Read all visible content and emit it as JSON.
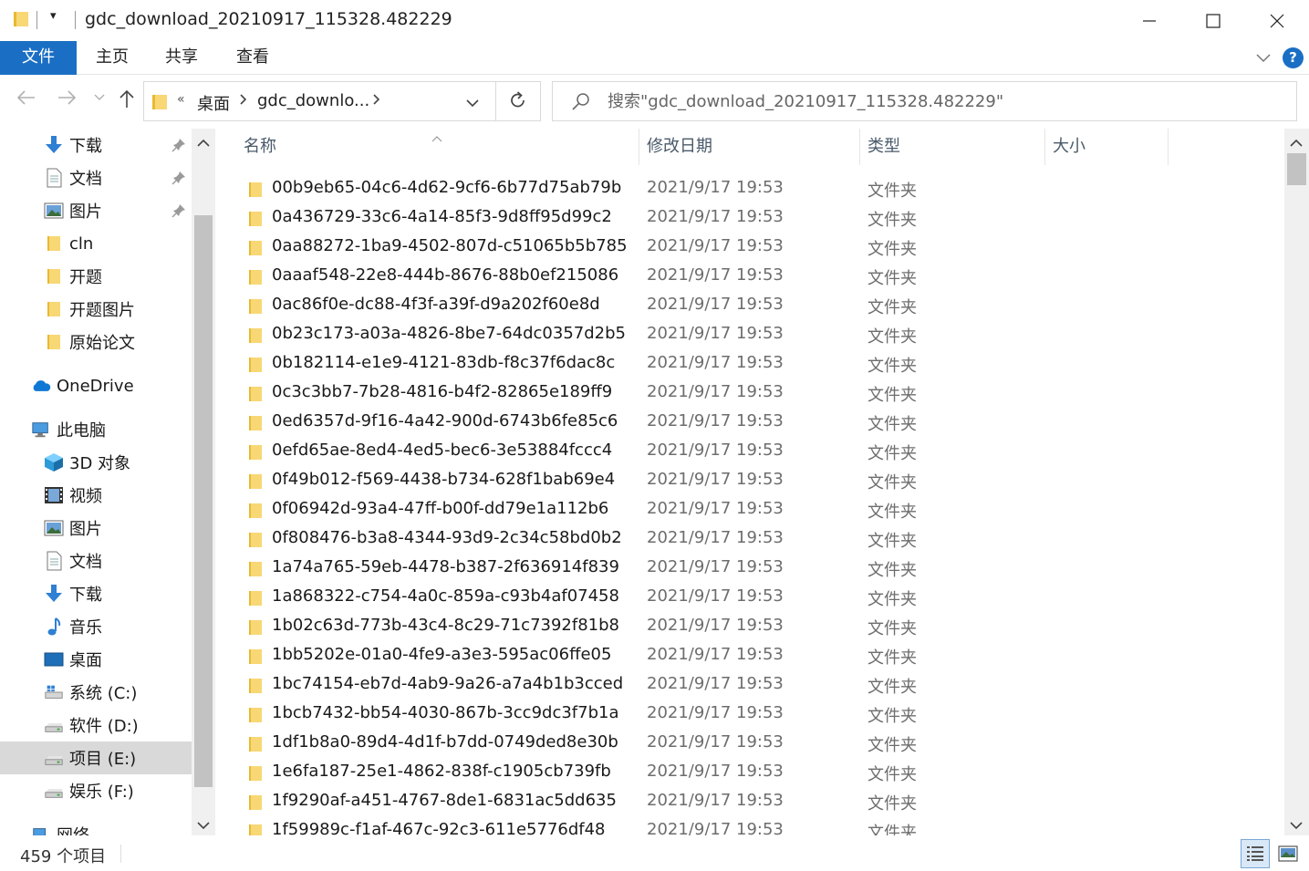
{
  "window": {
    "title": "gdc_download_20210917_115328.482229",
    "quick_access_dropdown": "▾"
  },
  "ribbon": {
    "tabs": [
      "文件",
      "主页",
      "共享",
      "查看"
    ],
    "help_label": "?"
  },
  "navbar": {
    "overflow": "«",
    "breadcrumb": [
      "桌面",
      "gdc_downlo..."
    ],
    "search_placeholder": "搜索\"gdc_download_20210917_115328.482229\""
  },
  "sidebar": {
    "items": [
      {
        "label": "下载",
        "icon": "download-arrow-icon",
        "pinned": true
      },
      {
        "label": "文档",
        "icon": "document-icon",
        "pinned": true
      },
      {
        "label": "图片",
        "icon": "pictures-icon",
        "pinned": true
      },
      {
        "label": "cln",
        "icon": "folder-icon",
        "pinned": false
      },
      {
        "label": "开题",
        "icon": "folder-icon",
        "pinned": false
      },
      {
        "label": "开题图片",
        "icon": "folder-icon",
        "pinned": false
      },
      {
        "label": "原始论文",
        "icon": "folder-icon",
        "pinned": false
      },
      {
        "label": "OneDrive",
        "icon": "onedrive-cloud-icon",
        "pinned": false
      },
      {
        "label": "此电脑",
        "icon": "this-pc-icon",
        "pinned": false
      },
      {
        "label": "3D 对象",
        "icon": "3d-objects-icon",
        "pinned": false
      },
      {
        "label": "视频",
        "icon": "videos-icon",
        "pinned": false
      },
      {
        "label": "图片",
        "icon": "pictures-icon",
        "pinned": false
      },
      {
        "label": "文档",
        "icon": "document-icon",
        "pinned": false
      },
      {
        "label": "下载",
        "icon": "download-arrow-icon",
        "pinned": false
      },
      {
        "label": "音乐",
        "icon": "music-note-icon",
        "pinned": false
      },
      {
        "label": "桌面",
        "icon": "desktop-icon",
        "pinned": false
      },
      {
        "label": "系统 (C:)",
        "icon": "windows-drive-icon",
        "pinned": false
      },
      {
        "label": "软件 (D:)",
        "icon": "drive-icon",
        "pinned": false
      },
      {
        "label": "项目 (E:)",
        "icon": "drive-icon",
        "pinned": false,
        "selected": true
      },
      {
        "label": "娱乐 (F:)",
        "icon": "drive-icon",
        "pinned": false
      },
      {
        "label": "网络",
        "icon": "network-icon",
        "pinned": false
      }
    ]
  },
  "columns": {
    "name": "名称",
    "date": "修改日期",
    "type": "类型",
    "size": "大小"
  },
  "files": [
    {
      "name": "00b9eb65-04c6-4d62-9cf6-6b77d75ab79b",
      "date": "2021/9/17 19:53",
      "type": "文件夹"
    },
    {
      "name": "0a436729-33c6-4a14-85f3-9d8ff95d99c2",
      "date": "2021/9/17 19:53",
      "type": "文件夹"
    },
    {
      "name": "0aa88272-1ba9-4502-807d-c51065b5b785",
      "date": "2021/9/17 19:53",
      "type": "文件夹"
    },
    {
      "name": "0aaaf548-22e8-444b-8676-88b0ef215086",
      "date": "2021/9/17 19:53",
      "type": "文件夹"
    },
    {
      "name": "0ac86f0e-dc88-4f3f-a39f-d9a202f60e8d",
      "date": "2021/9/17 19:53",
      "type": "文件夹"
    },
    {
      "name": "0b23c173-a03a-4826-8be7-64dc0357d2b5",
      "date": "2021/9/17 19:53",
      "type": "文件夹"
    },
    {
      "name": "0b182114-e1e9-4121-83db-f8c37f6dac8c",
      "date": "2021/9/17 19:53",
      "type": "文件夹"
    },
    {
      "name": "0c3c3bb7-7b28-4816-b4f2-82865e189ff9",
      "date": "2021/9/17 19:53",
      "type": "文件夹"
    },
    {
      "name": "0ed6357d-9f16-4a42-900d-6743b6fe85c6",
      "date": "2021/9/17 19:53",
      "type": "文件夹"
    },
    {
      "name": "0efd65ae-8ed4-4ed5-bec6-3e53884fccc4",
      "date": "2021/9/17 19:53",
      "type": "文件夹"
    },
    {
      "name": "0f49b012-f569-4438-b734-628f1bab69e4",
      "date": "2021/9/17 19:53",
      "type": "文件夹"
    },
    {
      "name": "0f06942d-93a4-47ff-b00f-dd79e1a112b6",
      "date": "2021/9/17 19:53",
      "type": "文件夹"
    },
    {
      "name": "0f808476-b3a8-4344-93d9-2c34c58bd0b2",
      "date": "2021/9/17 19:53",
      "type": "文件夹"
    },
    {
      "name": "1a74a765-59eb-4478-b387-2f636914f839",
      "date": "2021/9/17 19:53",
      "type": "文件夹"
    },
    {
      "name": "1a868322-c754-4a0c-859a-c93b4af07458",
      "date": "2021/9/17 19:53",
      "type": "文件夹"
    },
    {
      "name": "1b02c63d-773b-43c4-8c29-71c7392f81b8",
      "date": "2021/9/17 19:53",
      "type": "文件夹"
    },
    {
      "name": "1bb5202e-01a0-4fe9-a3e3-595ac06ffe05",
      "date": "2021/9/17 19:53",
      "type": "文件夹"
    },
    {
      "name": "1bc74154-eb7d-4ab9-9a26-a7a4b1b3cced",
      "date": "2021/9/17 19:53",
      "type": "文件夹"
    },
    {
      "name": "1bcb7432-bb54-4030-867b-3cc9dc3f7b1a",
      "date": "2021/9/17 19:53",
      "type": "文件夹"
    },
    {
      "name": "1df1b8a0-89d4-4d1f-b7dd-0749ded8e30b",
      "date": "2021/9/17 19:53",
      "type": "文件夹"
    },
    {
      "name": "1e6fa187-25e1-4862-838f-c1905cb739fb",
      "date": "2021/9/17 19:53",
      "type": "文件夹"
    },
    {
      "name": "1f9290af-a451-4767-8de1-6831ac5dd635",
      "date": "2021/9/17 19:53",
      "type": "文件夹"
    },
    {
      "name": "1f59989c-f1af-467c-92c3-611e5776df48",
      "date": "2021/9/17 19:53",
      "type": "文件夹"
    }
  ],
  "status": {
    "item_count": "459 个项目"
  },
  "colors": {
    "accent": "#1a6fc4",
    "folder": "#f8d775",
    "folder_dark": "#e8b931",
    "selected_bg": "#d9d9d9"
  }
}
